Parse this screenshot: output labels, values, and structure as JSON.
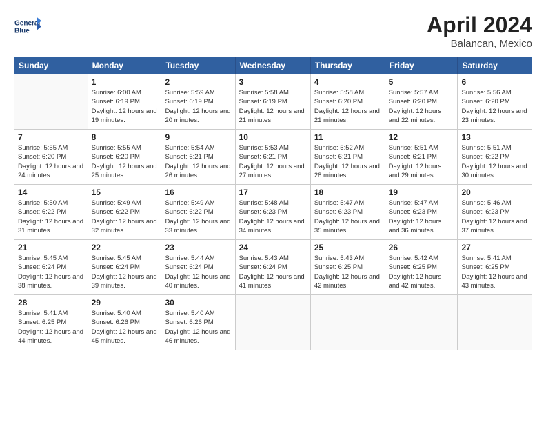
{
  "header": {
    "logo_line1": "General",
    "logo_line2": "Blue",
    "month_title": "April 2024",
    "location": "Balancan, Mexico"
  },
  "days_of_week": [
    "Sunday",
    "Monday",
    "Tuesday",
    "Wednesday",
    "Thursday",
    "Friday",
    "Saturday"
  ],
  "weeks": [
    [
      {
        "day": "",
        "sunrise": "",
        "sunset": "",
        "daylight": ""
      },
      {
        "day": "1",
        "sunrise": "Sunrise: 6:00 AM",
        "sunset": "Sunset: 6:19 PM",
        "daylight": "Daylight: 12 hours and 19 minutes."
      },
      {
        "day": "2",
        "sunrise": "Sunrise: 5:59 AM",
        "sunset": "Sunset: 6:19 PM",
        "daylight": "Daylight: 12 hours and 20 minutes."
      },
      {
        "day": "3",
        "sunrise": "Sunrise: 5:58 AM",
        "sunset": "Sunset: 6:19 PM",
        "daylight": "Daylight: 12 hours and 21 minutes."
      },
      {
        "day": "4",
        "sunrise": "Sunrise: 5:58 AM",
        "sunset": "Sunset: 6:20 PM",
        "daylight": "Daylight: 12 hours and 21 minutes."
      },
      {
        "day": "5",
        "sunrise": "Sunrise: 5:57 AM",
        "sunset": "Sunset: 6:20 PM",
        "daylight": "Daylight: 12 hours and 22 minutes."
      },
      {
        "day": "6",
        "sunrise": "Sunrise: 5:56 AM",
        "sunset": "Sunset: 6:20 PM",
        "daylight": "Daylight: 12 hours and 23 minutes."
      }
    ],
    [
      {
        "day": "7",
        "sunrise": "Sunrise: 5:55 AM",
        "sunset": "Sunset: 6:20 PM",
        "daylight": "Daylight: 12 hours and 24 minutes."
      },
      {
        "day": "8",
        "sunrise": "Sunrise: 5:55 AM",
        "sunset": "Sunset: 6:20 PM",
        "daylight": "Daylight: 12 hours and 25 minutes."
      },
      {
        "day": "9",
        "sunrise": "Sunrise: 5:54 AM",
        "sunset": "Sunset: 6:21 PM",
        "daylight": "Daylight: 12 hours and 26 minutes."
      },
      {
        "day": "10",
        "sunrise": "Sunrise: 5:53 AM",
        "sunset": "Sunset: 6:21 PM",
        "daylight": "Daylight: 12 hours and 27 minutes."
      },
      {
        "day": "11",
        "sunrise": "Sunrise: 5:52 AM",
        "sunset": "Sunset: 6:21 PM",
        "daylight": "Daylight: 12 hours and 28 minutes."
      },
      {
        "day": "12",
        "sunrise": "Sunrise: 5:51 AM",
        "sunset": "Sunset: 6:21 PM",
        "daylight": "Daylight: 12 hours and 29 minutes."
      },
      {
        "day": "13",
        "sunrise": "Sunrise: 5:51 AM",
        "sunset": "Sunset: 6:22 PM",
        "daylight": "Daylight: 12 hours and 30 minutes."
      }
    ],
    [
      {
        "day": "14",
        "sunrise": "Sunrise: 5:50 AM",
        "sunset": "Sunset: 6:22 PM",
        "daylight": "Daylight: 12 hours and 31 minutes."
      },
      {
        "day": "15",
        "sunrise": "Sunrise: 5:49 AM",
        "sunset": "Sunset: 6:22 PM",
        "daylight": "Daylight: 12 hours and 32 minutes."
      },
      {
        "day": "16",
        "sunrise": "Sunrise: 5:49 AM",
        "sunset": "Sunset: 6:22 PM",
        "daylight": "Daylight: 12 hours and 33 minutes."
      },
      {
        "day": "17",
        "sunrise": "Sunrise: 5:48 AM",
        "sunset": "Sunset: 6:23 PM",
        "daylight": "Daylight: 12 hours and 34 minutes."
      },
      {
        "day": "18",
        "sunrise": "Sunrise: 5:47 AM",
        "sunset": "Sunset: 6:23 PM",
        "daylight": "Daylight: 12 hours and 35 minutes."
      },
      {
        "day": "19",
        "sunrise": "Sunrise: 5:47 AM",
        "sunset": "Sunset: 6:23 PM",
        "daylight": "Daylight: 12 hours and 36 minutes."
      },
      {
        "day": "20",
        "sunrise": "Sunrise: 5:46 AM",
        "sunset": "Sunset: 6:23 PM",
        "daylight": "Daylight: 12 hours and 37 minutes."
      }
    ],
    [
      {
        "day": "21",
        "sunrise": "Sunrise: 5:45 AM",
        "sunset": "Sunset: 6:24 PM",
        "daylight": "Daylight: 12 hours and 38 minutes."
      },
      {
        "day": "22",
        "sunrise": "Sunrise: 5:45 AM",
        "sunset": "Sunset: 6:24 PM",
        "daylight": "Daylight: 12 hours and 39 minutes."
      },
      {
        "day": "23",
        "sunrise": "Sunrise: 5:44 AM",
        "sunset": "Sunset: 6:24 PM",
        "daylight": "Daylight: 12 hours and 40 minutes."
      },
      {
        "day": "24",
        "sunrise": "Sunrise: 5:43 AM",
        "sunset": "Sunset: 6:24 PM",
        "daylight": "Daylight: 12 hours and 41 minutes."
      },
      {
        "day": "25",
        "sunrise": "Sunrise: 5:43 AM",
        "sunset": "Sunset: 6:25 PM",
        "daylight": "Daylight: 12 hours and 42 minutes."
      },
      {
        "day": "26",
        "sunrise": "Sunrise: 5:42 AM",
        "sunset": "Sunset: 6:25 PM",
        "daylight": "Daylight: 12 hours and 42 minutes."
      },
      {
        "day": "27",
        "sunrise": "Sunrise: 5:41 AM",
        "sunset": "Sunset: 6:25 PM",
        "daylight": "Daylight: 12 hours and 43 minutes."
      }
    ],
    [
      {
        "day": "28",
        "sunrise": "Sunrise: 5:41 AM",
        "sunset": "Sunset: 6:25 PM",
        "daylight": "Daylight: 12 hours and 44 minutes."
      },
      {
        "day": "29",
        "sunrise": "Sunrise: 5:40 AM",
        "sunset": "Sunset: 6:26 PM",
        "daylight": "Daylight: 12 hours and 45 minutes."
      },
      {
        "day": "30",
        "sunrise": "Sunrise: 5:40 AM",
        "sunset": "Sunset: 6:26 PM",
        "daylight": "Daylight: 12 hours and 46 minutes."
      },
      {
        "day": "",
        "sunrise": "",
        "sunset": "",
        "daylight": ""
      },
      {
        "day": "",
        "sunrise": "",
        "sunset": "",
        "daylight": ""
      },
      {
        "day": "",
        "sunrise": "",
        "sunset": "",
        "daylight": ""
      },
      {
        "day": "",
        "sunrise": "",
        "sunset": "",
        "daylight": ""
      }
    ]
  ]
}
